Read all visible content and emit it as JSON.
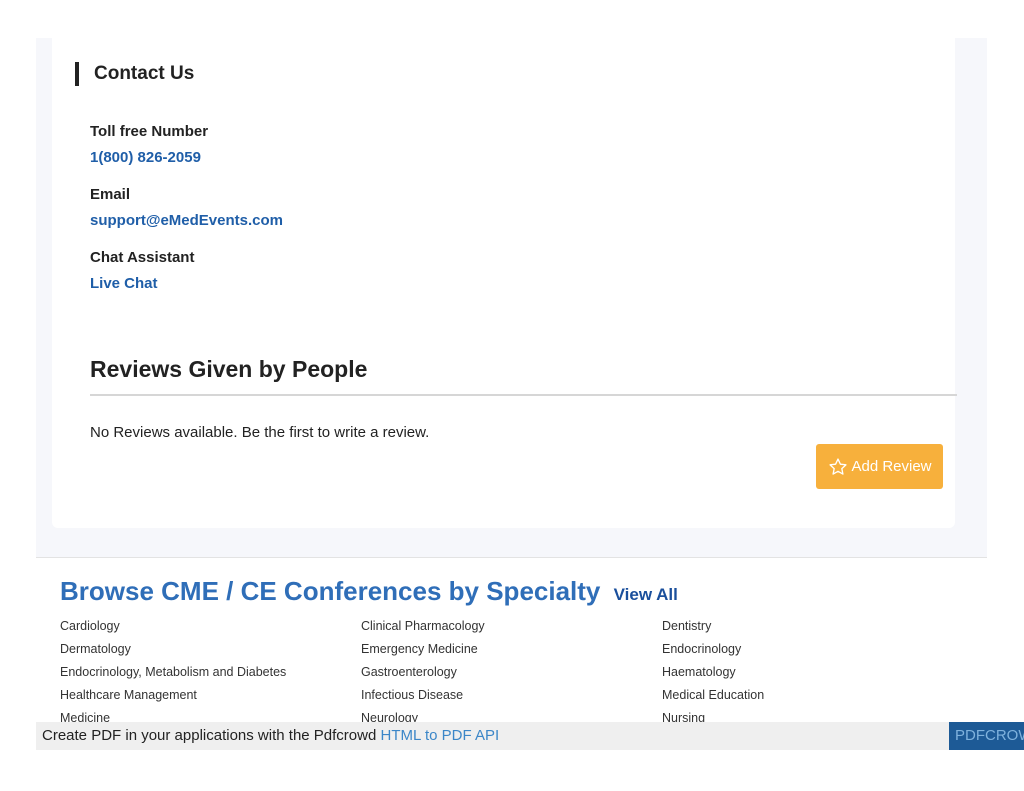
{
  "contact": {
    "title": "Contact Us",
    "toll_free_label": "Toll free Number",
    "toll_free_value": "1(800) 826-2059",
    "email_label": "Email",
    "email_value": "support@eMedEvents.com",
    "chat_label": "Chat Assistant",
    "chat_value": "Live Chat"
  },
  "reviews": {
    "title": "Reviews Given by People",
    "empty_text": "No Reviews available. Be the first to write a review.",
    "add_button_label": "Add Review",
    "add_button_icon": "star-outline-icon",
    "button_color": "#f7b03c"
  },
  "browse": {
    "title": "Browse CME / CE Conferences by Specialty",
    "view_all": "View All",
    "title_color": "#2f6eb8",
    "columns": [
      [
        "Cardiology",
        "Dermatology",
        "Endocrinology, Metabolism and Diabetes",
        "Healthcare Management",
        "Medicine"
      ],
      [
        "Clinical Pharmacology",
        "Emergency Medicine",
        "Gastroenterology",
        "Infectious Disease",
        "Neurology"
      ],
      [
        "Dentistry",
        "Endocrinology",
        "Haematology",
        "Medical Education",
        "Nursing"
      ]
    ]
  },
  "pdf_bar": {
    "text": "Create PDF in your applications with the Pdfcrowd",
    "link": "HTML to PDF API",
    "badge": "PDFCROWD"
  }
}
